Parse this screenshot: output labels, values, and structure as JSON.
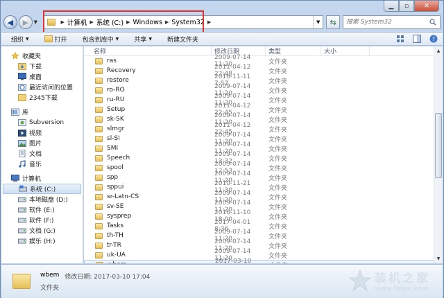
{
  "address": {
    "crumbs": [
      "计算机",
      "系统 (C:)",
      "Windows",
      "System32"
    ]
  },
  "search": {
    "placeholder": "搜索 System32"
  },
  "toolbar": {
    "organize": "组织",
    "open": "打开",
    "include": "包含到库中",
    "share": "共享",
    "new_folder": "新建文件夹"
  },
  "nav": {
    "favorites": {
      "label": "收藏夹",
      "items": [
        "下载",
        "桌面",
        "最近访问的位置",
        "2345下载"
      ]
    },
    "libraries": {
      "label": "库",
      "items": [
        "Subversion",
        "视频",
        "图片",
        "文档",
        "音乐"
      ]
    },
    "computer": {
      "label": "计算机",
      "items": [
        "系统 (C:)",
        "本地磁盘 (D:)",
        "软件 (E:)",
        "软件 (F:)",
        "文档 (G:)",
        "娱乐 (H:)"
      ]
    }
  },
  "columns": {
    "name": "名称",
    "date": "修改日期",
    "type": "类型",
    "size": "大小"
  },
  "files": [
    {
      "name": "ras",
      "date": "2009-07-14 11:20",
      "type": "文件夹"
    },
    {
      "name": "Recovery",
      "date": "2011-04-12 22:48",
      "type": "文件夹"
    },
    {
      "name": "restore",
      "date": "2016-11-11 7:57",
      "type": "文件夹"
    },
    {
      "name": "ro-RO",
      "date": "2009-07-14 11:20",
      "type": "文件夹"
    },
    {
      "name": "ru-RU",
      "date": "2009-07-14 11:20",
      "type": "文件夹"
    },
    {
      "name": "Setup",
      "date": "2011-04-12 22:45",
      "type": "文件夹"
    },
    {
      "name": "sk-SK",
      "date": "2009-07-14 11:20",
      "type": "文件夹"
    },
    {
      "name": "slmgr",
      "date": "2011-04-12 22:45",
      "type": "文件夹"
    },
    {
      "name": "sl-SI",
      "date": "2009-07-14 11:20",
      "type": "文件夹"
    },
    {
      "name": "SMI",
      "date": "2009-07-14 11:20",
      "type": "文件夹"
    },
    {
      "name": "Speech",
      "date": "2009-07-14 13:32",
      "type": "文件夹"
    },
    {
      "name": "spool",
      "date": "2009-07-14 12:53",
      "type": "文件夹"
    },
    {
      "name": "spp",
      "date": "2009-07-14 11:20",
      "type": "文件夹"
    },
    {
      "name": "sppui",
      "date": "2010-11-21 11:30",
      "type": "文件夹"
    },
    {
      "name": "sr-Latn-CS",
      "date": "2009-07-14 11:20",
      "type": "文件夹"
    },
    {
      "name": "sv-SE",
      "date": "2009-07-14 11:20",
      "type": "文件夹"
    },
    {
      "name": "sysprep",
      "date": "2016-11-10 18:00",
      "type": "文件夹"
    },
    {
      "name": "Tasks",
      "date": "2017-04-01 8:36",
      "type": "文件夹"
    },
    {
      "name": "th-TH",
      "date": "2009-07-14 11:20",
      "type": "文件夹"
    },
    {
      "name": "tr-TR",
      "date": "2009-07-14 11:20",
      "type": "文件夹"
    },
    {
      "name": "uk-UA",
      "date": "2009-07-14 11:20",
      "type": "文件夹"
    },
    {
      "name": "wbem",
      "date": "2017-03-10 17:04",
      "type": "文件夹"
    }
  ],
  "selected_index": 21,
  "details": {
    "name": "wbem",
    "meta": "修改日期: 2017-03-10 17:04",
    "type": "文件夹"
  },
  "watermark": {
    "name": "装机之家",
    "url": "www.lotpc.com"
  },
  "colors": {
    "highlight": "#e03030",
    "selection": "#cfe0f4"
  }
}
